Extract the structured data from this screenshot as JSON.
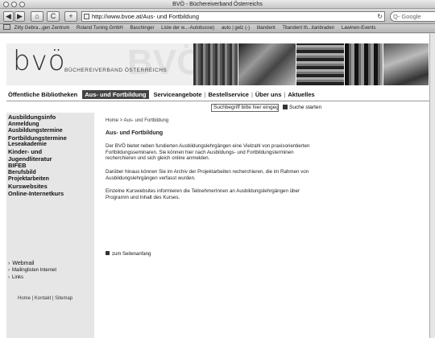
{
  "window": {
    "title": "BVÖ - Büchereiverband Österreichs"
  },
  "toolbar": {
    "url": "http://www.bvoe.at/Aus- und Fortbildung",
    "search_placeholder": "Q- Google",
    "back_glyph": "◀",
    "forward_glyph": "▶",
    "home_glyph": "⌂",
    "reload_glyph": "C",
    "add_glyph": "+"
  },
  "bookmarks": [
    "Zitty Gebra...gen Zentrum",
    "Roland Tuning GmbH",
    "Baschinger",
    "Liste der w...-Autobusse)",
    "auto | gelz (-)",
    "titandent",
    "Titandent th...itanbraden",
    "Lawinen-Events"
  ],
  "header": {
    "logo": "bvö",
    "logo_sub": "BÜCHEREIVERBAND ÖSTERREICHS",
    "watermark": "BVÖ"
  },
  "topnav": [
    {
      "label": "Öffentliche Bibliotheken",
      "active": false
    },
    {
      "label": "Aus- und Fortbildung",
      "active": true
    },
    {
      "label": "Serviceangebote",
      "active": false
    },
    {
      "label": "Bestellservice",
      "active": false
    },
    {
      "label": "Über uns",
      "active": false
    },
    {
      "label": "Aktuelles",
      "active": false
    }
  ],
  "search": {
    "placeholder": "Suchbegriff bitte hier eingeg",
    "button": "Suche starten"
  },
  "sidebar": {
    "items": [
      "Ausbildungsinfo",
      "Anmeldung",
      "Ausbildungstermine",
      "Fortbildungstermine",
      "Leseakademie",
      "Kinder- und",
      "Jugendliteratur",
      "BIFEB",
      "Berufsbild",
      "Projektarbeiten",
      "Kurswebsites",
      "Online-Internetkurs"
    ],
    "links": [
      "Webmail",
      "Mailinglisten Internet",
      "Links"
    ],
    "footer": "Home | Kontakt | Sitemap"
  },
  "content": {
    "breadcrumb": "Home > Aus- und Fortbildung",
    "title": "Aus- und Fortbildung",
    "paragraphs": [
      "Der BVÖ bietet neben fundierten Ausbildungslehrgängen eine Vielzahl von praxisorientierten Fortbildungsseminaren. Sie können hier nach Ausbildungs- und Fortbildungsterminen recherchieren und sich gleich online anmelden.",
      "Darüber hinaus können Sie im Archiv der Projektarbeiten recherchieren, die im Rahmen von Ausbildungslehrgängen verfasst wurden.",
      "Einzelne Kurswebsites informieren die TeilnehmerInnen an Ausbildungslehrgängen über Programm und Inhalt des Kurses."
    ],
    "back_link": "zum Seitenanfang"
  }
}
